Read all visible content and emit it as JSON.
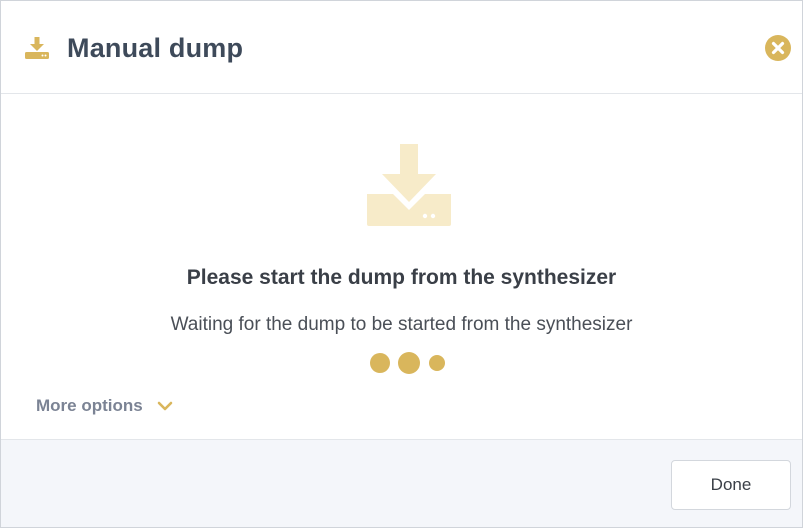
{
  "dialog": {
    "title": "Manual dump",
    "header_icon": "download-icon",
    "close_icon": "close-circle-icon"
  },
  "content": {
    "icon": "download-to-device-icon",
    "heading": "Please start the dump from the synthesizer",
    "message": "Waiting for the dump to be started from the synthesizer",
    "loader": "loading-dots-icon"
  },
  "more_options": {
    "label": "More options",
    "icon": "chevron-down-icon"
  },
  "footer": {
    "done_label": "Done"
  },
  "colors": {
    "accent": "#d9b65c",
    "accent_light": "#f7ebc9",
    "title_text": "#3e4a5a",
    "muted_text": "#7b8394",
    "footer_bg": "#f4f6fa"
  }
}
